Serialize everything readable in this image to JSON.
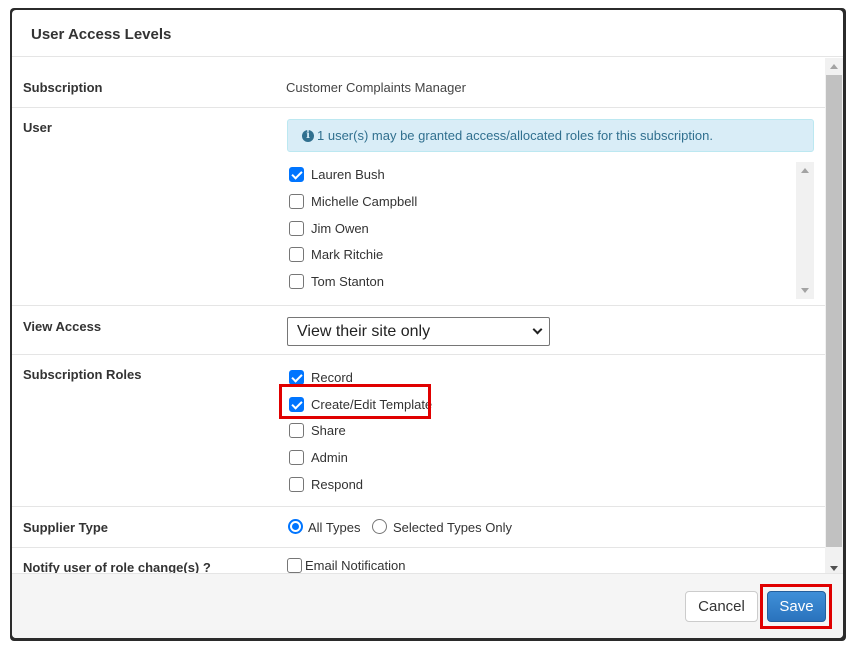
{
  "modal": {
    "title": "User Access Levels"
  },
  "subscription": {
    "label": "Subscription",
    "value": "Customer Complaints Manager"
  },
  "user": {
    "label": "User",
    "info_icon": "info-circle-icon",
    "info_text": "1 user(s) may be granted access/allocated roles for this subscription.",
    "users": [
      {
        "name": "Lauren Bush",
        "checked": true
      },
      {
        "name": "Michelle Campbell",
        "checked": false
      },
      {
        "name": "Jim Owen",
        "checked": false
      },
      {
        "name": "Mark Ritchie",
        "checked": false
      },
      {
        "name": "Tom Stanton",
        "checked": false
      }
    ]
  },
  "view_access": {
    "label": "View Access",
    "selected": "View their site only"
  },
  "roles": {
    "label": "Subscription Roles",
    "items": [
      {
        "name": "Record",
        "checked": true
      },
      {
        "name": "Create/Edit Template",
        "checked": true
      },
      {
        "name": "Share",
        "checked": false
      },
      {
        "name": "Admin",
        "checked": false
      },
      {
        "name": "Respond",
        "checked": false
      }
    ]
  },
  "supplier_type": {
    "label": "Supplier Type",
    "options": [
      {
        "name": "All Types",
        "checked": true
      },
      {
        "name": "Selected Types Only",
        "checked": false
      }
    ]
  },
  "notify": {
    "label": "Notify user of role change(s) ?",
    "checkbox_label": "Email Notification",
    "checked": false
  },
  "footer": {
    "cancel_label": "Cancel",
    "save_label": "Save"
  },
  "colors": {
    "accent": "#0075ff",
    "save_button": "#2f7fcc",
    "info_bg": "#d9edf7",
    "info_text": "#31708f",
    "highlight": "#e00000"
  }
}
